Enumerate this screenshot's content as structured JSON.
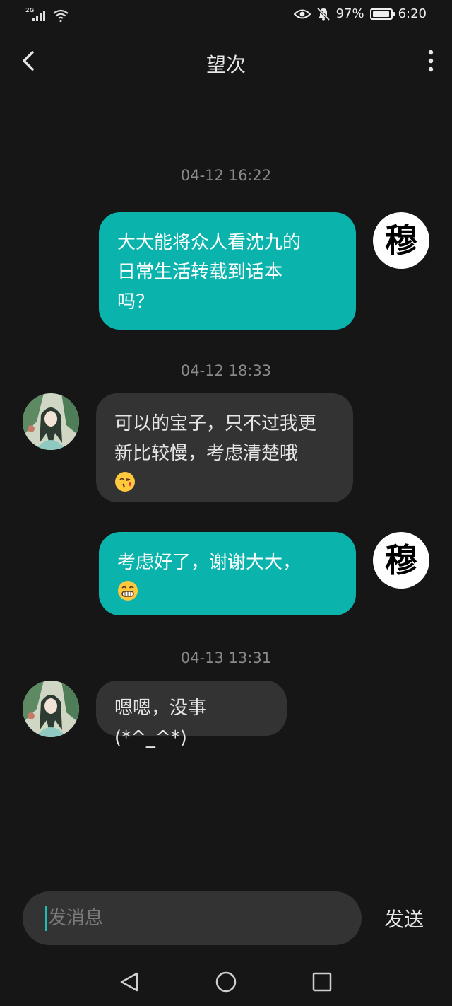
{
  "status_bar": {
    "network_tag": "2G",
    "battery_percent": "97%",
    "battery_level": 0.97,
    "time": "6:20",
    "icons": [
      "signal-icon",
      "wifi-icon",
      "eye-icon",
      "mute-bell-icon",
      "battery-icon"
    ]
  },
  "header": {
    "title": "望次",
    "back_icon": "chevron-left-icon",
    "more_icon": "more-vertical-icon"
  },
  "messages": [
    {
      "timestamp": "04-12 16:22",
      "sender": "me",
      "lines": [
        "大大能将众人看沈九的",
        "日常生活转载到话本",
        "吗？"
      ],
      "emoji": null
    },
    {
      "timestamp": "04-12 18:33",
      "sender": "them",
      "lines": [
        "可以的宝子，只不过我更",
        "新比较慢，考虑清楚哦"
      ],
      "emoji": "kissing-face-emoji"
    },
    {
      "timestamp": "",
      "sender": "me",
      "lines": [
        "考虑好了，谢谢大大，"
      ],
      "emoji": "grinning-face-emoji"
    },
    {
      "timestamp": "04-13 13:31",
      "sender": "them",
      "lines": [
        "嗯嗯，没事(*^_^*)"
      ],
      "emoji": null
    }
  ],
  "avatars": {
    "me_glyph": "穆"
  },
  "input": {
    "placeholder": "发消息",
    "send_label": "发送"
  },
  "nav": {
    "icons": [
      "back-triangle-icon",
      "home-circle-icon",
      "recents-square-icon"
    ]
  },
  "colors": {
    "background": "#161616",
    "my_bubble": "#0bb3ad",
    "their_bubble": "#333333",
    "accent": "#1fbdb6"
  }
}
